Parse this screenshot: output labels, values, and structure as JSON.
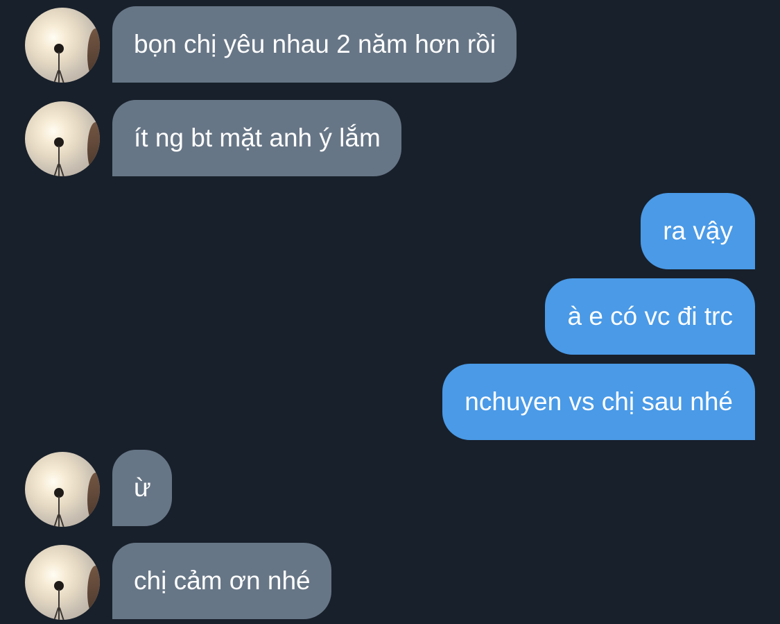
{
  "colors": {
    "background": "#18202b",
    "received_bubble": "#677686",
    "sent_bubble": "#4a9ae7",
    "text": "#ffffff"
  },
  "messages": [
    {
      "direction": "received",
      "text": "bọn chị yêu nhau 2 năm hơn rồi",
      "avatar": "contact-avatar"
    },
    {
      "direction": "received",
      "text": "ít ng bt mặt anh ý lắm",
      "avatar": "contact-avatar"
    },
    {
      "direction": "sent",
      "text": "ra vậy"
    },
    {
      "direction": "sent",
      "text": "à e có vc đi trc"
    },
    {
      "direction": "sent",
      "text": "nchuyen vs chị sau nhé"
    },
    {
      "direction": "received",
      "text": "ừ",
      "avatar": "contact-avatar"
    },
    {
      "direction": "received",
      "text": "chị cảm ơn nhé",
      "avatar": "contact-avatar"
    }
  ]
}
